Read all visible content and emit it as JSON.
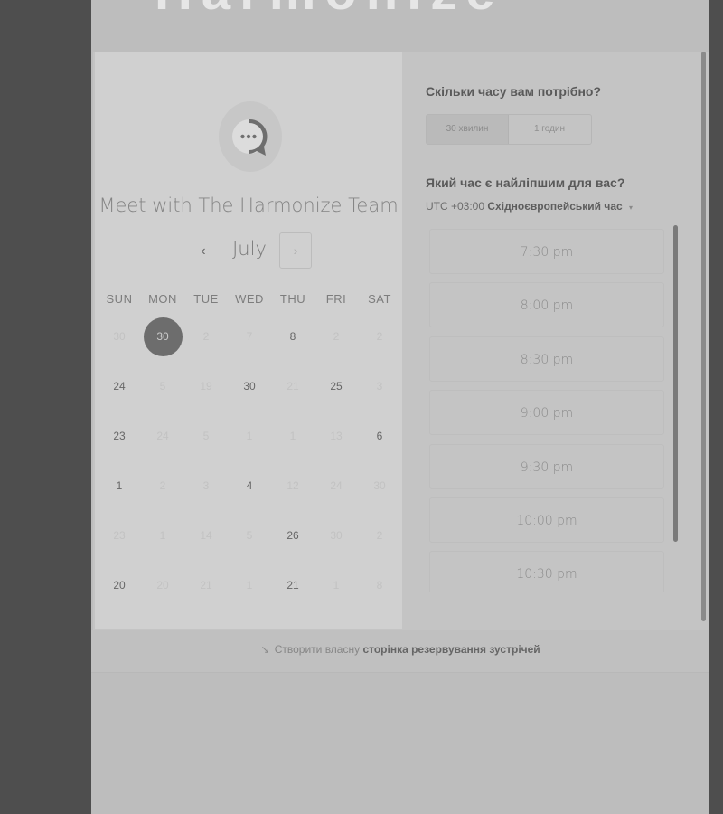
{
  "header": {
    "brand_text": "Harmonize"
  },
  "calendar": {
    "title": "Meet with The Harmonize Team",
    "month": "July",
    "prev_icon": "‹",
    "next_icon": "›",
    "weekdays": [
      "SUN",
      "MON",
      "TUE",
      "WED",
      "THU",
      "FRI",
      "SAT"
    ],
    "weeks": [
      [
        {
          "label": "30",
          "available": false
        },
        {
          "label": "30",
          "available": true,
          "selected": true
        },
        {
          "label": "2",
          "available": false
        },
        {
          "label": "7",
          "available": false
        },
        {
          "label": "8",
          "available": true
        },
        {
          "label": "2",
          "available": false
        },
        {
          "label": "2",
          "available": false
        }
      ],
      [
        {
          "label": "24",
          "available": true
        },
        {
          "label": "5",
          "available": false
        },
        {
          "label": "19",
          "available": false
        },
        {
          "label": "30",
          "available": true
        },
        {
          "label": "21",
          "available": false
        },
        {
          "label": "25",
          "available": true
        },
        {
          "label": "3",
          "available": false
        }
      ],
      [
        {
          "label": "23",
          "available": true
        },
        {
          "label": "24",
          "available": false
        },
        {
          "label": "5",
          "available": false
        },
        {
          "label": "1",
          "available": false
        },
        {
          "label": "1",
          "available": false
        },
        {
          "label": "13",
          "available": false
        },
        {
          "label": "6",
          "available": true
        }
      ],
      [
        {
          "label": "1",
          "available": true
        },
        {
          "label": "2",
          "available": false
        },
        {
          "label": "3",
          "available": false
        },
        {
          "label": "4",
          "available": true
        },
        {
          "label": "12",
          "available": false
        },
        {
          "label": "24",
          "available": false
        },
        {
          "label": "30",
          "available": false
        }
      ],
      [
        {
          "label": "23",
          "available": false
        },
        {
          "label": "1",
          "available": false
        },
        {
          "label": "14",
          "available": false
        },
        {
          "label": "5",
          "available": false
        },
        {
          "label": "26",
          "available": true
        },
        {
          "label": "30",
          "available": false
        },
        {
          "label": "2",
          "available": false
        }
      ],
      [
        {
          "label": "20",
          "available": true
        },
        {
          "label": "20",
          "available": false
        },
        {
          "label": "21",
          "available": false
        },
        {
          "label": "1",
          "available": false
        },
        {
          "label": "21",
          "available": true
        },
        {
          "label": "1",
          "available": false
        },
        {
          "label": "8",
          "available": false
        }
      ]
    ]
  },
  "booking": {
    "duration_question": "Скільки часу вам потрібно?",
    "durations": [
      {
        "label": "30 хвилин",
        "active": true
      },
      {
        "label": "1 годин",
        "active": false
      }
    ],
    "time_question": "Який час є найліпшим для вас?",
    "timezone_offset": "UTC +03:00",
    "timezone_name": "Східноєвропейський час",
    "timezone_caret": "▾",
    "slots": [
      "7:30 pm",
      "8:00 pm",
      "8:30 pm",
      "9:00 pm",
      "9:30 pm",
      "10:00 pm",
      "10:30 pm"
    ]
  },
  "footer": {
    "icon": "↘",
    "prefix": "Створити власну",
    "link": "сторінка резервування зустрічей"
  },
  "colors": {
    "selected_day": "#6d6d6d",
    "overlay_background": "#4e4e4e"
  }
}
